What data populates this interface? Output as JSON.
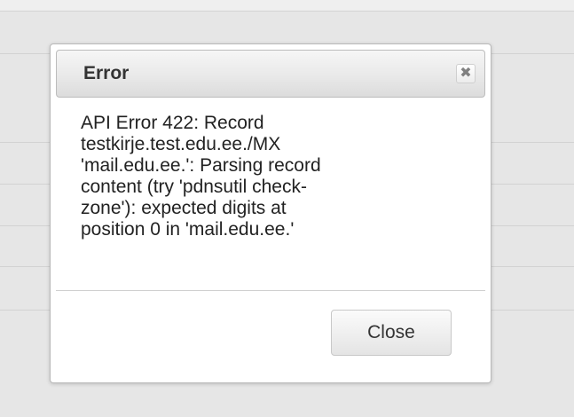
{
  "dialog": {
    "title": "Error",
    "close_icon": "close-icon",
    "message_lines": [
      "API Error 422: Record",
      "testkirje.test.edu.ee./MX",
      "'mail.edu.ee.': Parsing record",
      "content (try 'pdnsutil check-",
      "zone'): expected digits at",
      "position 0 in 'mail.edu.ee.'"
    ],
    "close_label": "Close"
  },
  "colors": {
    "overlay_background": "#e6e6e6",
    "dialog_background": "#ffffff",
    "title_text": "#333333",
    "message_text": "#222222"
  }
}
